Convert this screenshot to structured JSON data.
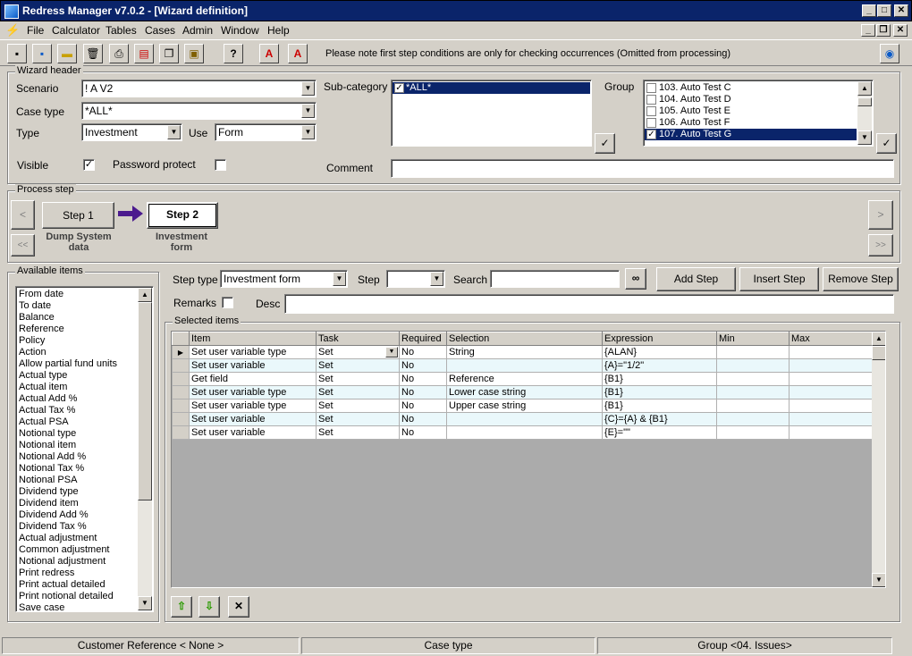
{
  "window": {
    "title": "Redress Manager v7.0.2 - [Wizard definition]"
  },
  "menu": [
    "File",
    "Calculator",
    "Tables",
    "Cases",
    "Admin",
    "Window",
    "Help"
  ],
  "toolbar": {
    "note": "Please note first step conditions are only for checking occurrences (Omitted from processing)"
  },
  "header": {
    "legend": "Wizard header",
    "scenario_label": "Scenario",
    "scenario_value": "! A V2",
    "case_type_label": "Case type",
    "case_type_value": "*ALL*",
    "type_label": "Type",
    "type_value": "Investment",
    "use_label": "Use",
    "use_value": "Form",
    "visible_label": "Visible",
    "password_label": "Password protect",
    "subcat_label": "Sub-category",
    "subcat_items": [
      "*ALL*"
    ],
    "group_label": "Group",
    "group_items": [
      "103. Auto Test C",
      "104. Auto Test D",
      "105. Auto Test E",
      "106. Auto Test F",
      "107. Auto Test G"
    ],
    "comment_label": "Comment",
    "comment_value": ""
  },
  "process": {
    "legend": "Process step",
    "step1_label": "Step 1",
    "step1_caption_1": "Dump System",
    "step1_caption_2": "data",
    "step2_label": "Step 2",
    "step2_caption_1": "Investment",
    "step2_caption_2": "form",
    "prev": "<",
    "first": "<<",
    "next": ">",
    "last": ">>"
  },
  "available": {
    "legend": "Available items",
    "items": [
      "From date",
      "To date",
      "Balance",
      "Reference",
      "Policy",
      "Action",
      "Allow partial fund units",
      "Actual type",
      "Actual item",
      "Actual Add %",
      "Actual Tax %",
      "Actual PSA",
      "Notional type",
      "Notional item",
      "Notional Add %",
      "Notional Tax %",
      "Notional PSA",
      "Dividend type",
      "Dividend item",
      "Dividend Add %",
      "Dividend Tax %",
      "Actual adjustment",
      "Common adjustment",
      "Notional adjustment",
      "Print redress",
      "Print actual detailed",
      "Print notional detailed",
      "Save case"
    ]
  },
  "editor": {
    "step_type_label": "Step type",
    "step_type_value": "Investment form",
    "step_label": "Step",
    "step_value": "",
    "search_label": "Search",
    "search_value": "",
    "add_step": "Add Step",
    "insert_step": "Insert Step",
    "remove_step": "Remove Step",
    "remarks_label": "Remarks",
    "desc_label": "Desc",
    "desc_value": "",
    "selected_legend": "Selected items",
    "columns": [
      "Item",
      "Task",
      "Required",
      "Selection",
      "Expression",
      "Min",
      "Max"
    ],
    "rows": [
      [
        "Set user variable type",
        "Set",
        "No",
        "String",
        "{ALAN}",
        "",
        ""
      ],
      [
        "Set user variable",
        "Set",
        "No",
        "",
        "{A}=\"1/2\"",
        "",
        ""
      ],
      [
        "Get field",
        "Set",
        "No",
        "Reference",
        "{B1}",
        "",
        ""
      ],
      [
        "Set user variable type",
        "Set",
        "No",
        "Lower case string",
        "{B1}",
        "",
        ""
      ],
      [
        "Set user variable type",
        "Set",
        "No",
        "Upper case string",
        "{B1}",
        "",
        ""
      ],
      [
        "Set user variable",
        "Set",
        "No",
        "",
        "{C}={A} & {B1}",
        "",
        ""
      ],
      [
        "Set user variable",
        "Set",
        "No",
        "",
        "{E}=\"\"",
        "",
        ""
      ]
    ]
  },
  "status": {
    "customer": "Customer Reference < None >",
    "case_type": "Case type",
    "group": "Group <04. Issues>"
  }
}
